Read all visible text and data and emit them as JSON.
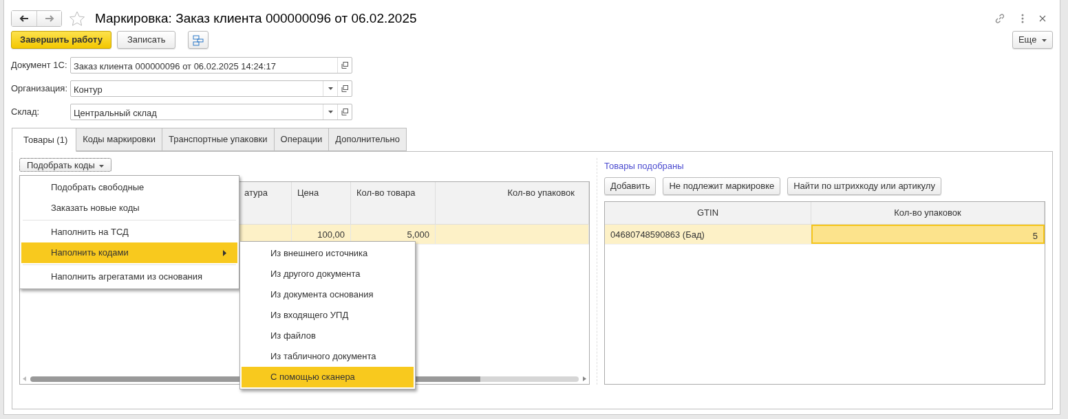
{
  "window": {
    "title": "Маркировка: Заказ клиента 000000096 от 06.02.2025"
  },
  "toolbar": {
    "buttons": [
      {
        "label": "Завершить работу",
        "kind": "primary"
      },
      {
        "label": "Записать",
        "kind": "default"
      },
      {
        "kind": "icon"
      }
    ],
    "more": "Еще"
  },
  "fields": [
    {
      "label": "Документ 1С:",
      "value": "Заказ клиента 000000096 от 06.02.2025 14:24:17",
      "dropdown": false
    },
    {
      "label": "Организация:",
      "value": "Контур",
      "dropdown": true
    },
    {
      "label": "Склад:",
      "value": "Центральный склад",
      "dropdown": true
    }
  ],
  "tabs": [
    {
      "label": "Товары (1)",
      "selected": true
    },
    {
      "label": "Коды маркировки",
      "selected": false
    },
    {
      "label": "Транспортные упаковки",
      "selected": false
    },
    {
      "label": "Операции",
      "selected": false
    },
    {
      "label": "Дополнительно",
      "selected": false
    }
  ],
  "goods": {
    "button": "Подобрать коды",
    "table": {
      "columns": [
        "атура",
        "Цена",
        "Кол-во товара",
        "Кол-во упаковок"
      ],
      "rows": [
        {
          "cells": [
            null,
            "100,00",
            "5,000",
            null
          ],
          "selected": true
        }
      ]
    }
  },
  "menu": {
    "items": [
      {
        "kind": "item",
        "label": "Подобрать свободные",
        "selected": false,
        "submenu": false
      },
      {
        "kind": "item",
        "label": "Заказать новые коды",
        "selected": false,
        "submenu": false
      },
      {
        "kind": "separator"
      },
      {
        "kind": "item",
        "label": "Наполнить на ТСД",
        "selected": false,
        "submenu": false
      },
      {
        "kind": "item",
        "label": "Наполнить кодами",
        "selected": true,
        "submenu": true
      },
      {
        "kind": "separator"
      },
      {
        "kind": "item",
        "label": "Наполнить агрегатами из основания",
        "selected": false,
        "submenu": false
      }
    ]
  },
  "submenu": {
    "items": [
      {
        "label": "Из внешнего источника",
        "selected": false
      },
      {
        "label": "Из другого документа",
        "selected": false
      },
      {
        "label": "Из документа основания",
        "selected": false
      },
      {
        "label": "Из входящего УПД",
        "selected": false
      },
      {
        "label": "Из файлов",
        "selected": false
      },
      {
        "label": "Из табличного документа",
        "selected": false
      },
      {
        "label": "С помощью сканера",
        "selected": true
      }
    ]
  },
  "picked": {
    "title": "Товары подобраны",
    "buttons": [
      "Добавить",
      "Не подлежит маркировке",
      "Найти по штрихкоду или артикулу"
    ],
    "table": {
      "columns": [
        "GTIN",
        "Кол-во упаковок"
      ],
      "rows": [
        {
          "cells": [
            {
              "text": "04680748590863 (Бад)",
              "active": false
            },
            {
              "text": "5",
              "active": true
            }
          ],
          "selected": true
        }
      ]
    }
  }
}
